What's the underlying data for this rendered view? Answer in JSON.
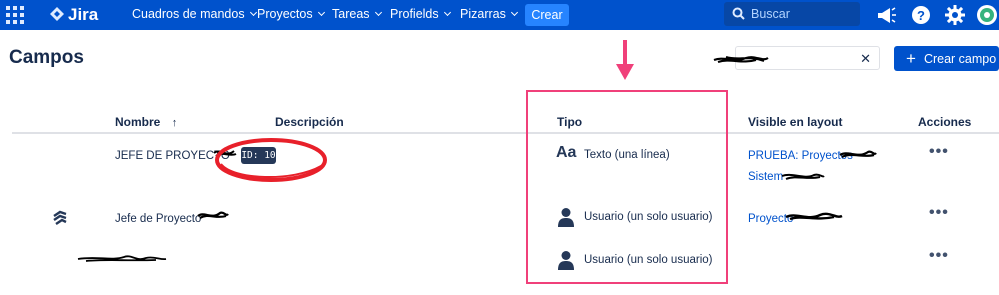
{
  "nav": {
    "logo_text": "Jira",
    "items": [
      {
        "label": "Cuadros de mandos"
      },
      {
        "label": "Proyectos"
      },
      {
        "label": "Tareas"
      },
      {
        "label": "Profields"
      },
      {
        "label": "Pizarras"
      }
    ],
    "create_label": "Crear",
    "search_placeholder": "Buscar",
    "icons": [
      "app-switcher-icon",
      "notifications-icon",
      "help-icon",
      "settings-icon",
      "avatar"
    ]
  },
  "page": {
    "title": "Campos",
    "add_field_label": "Crear campo",
    "filter_clear": "✕"
  },
  "table": {
    "columns": {
      "name": "Nombre",
      "sort_arrow": "↑",
      "description": "Descripción",
      "type": "Tipo",
      "visible_in_layout": "Visible en layout",
      "actions": "Acciones"
    },
    "rows": [
      {
        "name": "JEFE DE PROYECTO",
        "id_badge": "ID: 10",
        "type_label": "Texto (una línea)",
        "type_glyph": "Aa",
        "layouts": [
          "PRUEBA: Proyectos",
          "Sistem"
        ],
        "actions": "•••"
      },
      {
        "name": "Jefe de Proyecto",
        "type_label": "Usuario (un solo usuario)",
        "layouts": [
          "Proyecto"
        ],
        "actions": "•••"
      },
      {
        "name": "",
        "type_label": "Usuario (un solo usuario)",
        "layouts": [],
        "actions": "•••"
      }
    ]
  },
  "colors": {
    "nav_bg": "#0052cc",
    "primary": "#0052cc",
    "annotation": "#f0407a",
    "highlight": "#e8202a"
  }
}
